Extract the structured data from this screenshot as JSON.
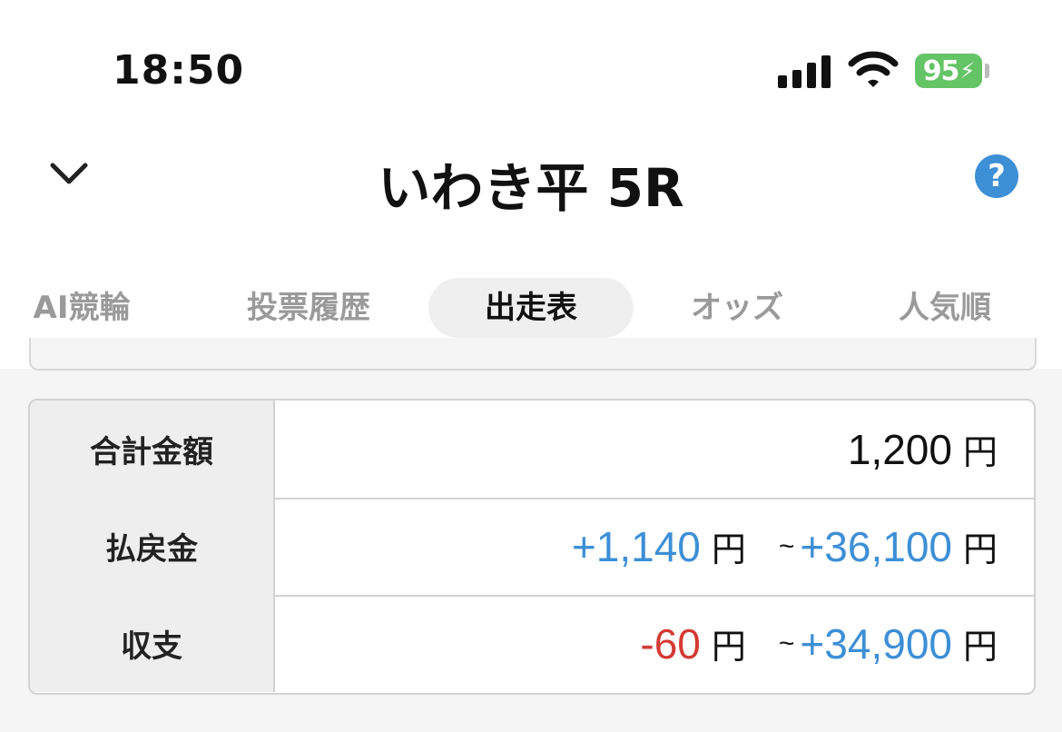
{
  "status_bar": {
    "time": "18:50",
    "battery_level": "95",
    "battery_color": "#65c466"
  },
  "header": {
    "back_icon": "chevron-down-icon",
    "title": "いわき平 5R",
    "help_label": "?"
  },
  "tabs": [
    {
      "label": "AI競輪",
      "active": false
    },
    {
      "label": "投票履歴",
      "active": false
    },
    {
      "label": "出走表",
      "active": true
    },
    {
      "label": "オッズ",
      "active": false
    },
    {
      "label": "人気順",
      "active": false
    }
  ],
  "summary": {
    "total": {
      "label": "合計金額",
      "amount": "1,200",
      "unit": "円"
    },
    "payout": {
      "label": "払戻金",
      "min": "+1,140",
      "min_unit": "円",
      "tilde": "~",
      "max": "+36,100",
      "max_unit": "円"
    },
    "balance": {
      "label": "収支",
      "min": "-60",
      "min_unit": "円",
      "tilde": "~",
      "max": "+34,900",
      "max_unit": "円"
    }
  },
  "colors": {
    "accent_blue": "#3d8fd6",
    "negative_red": "#d43b33"
  }
}
